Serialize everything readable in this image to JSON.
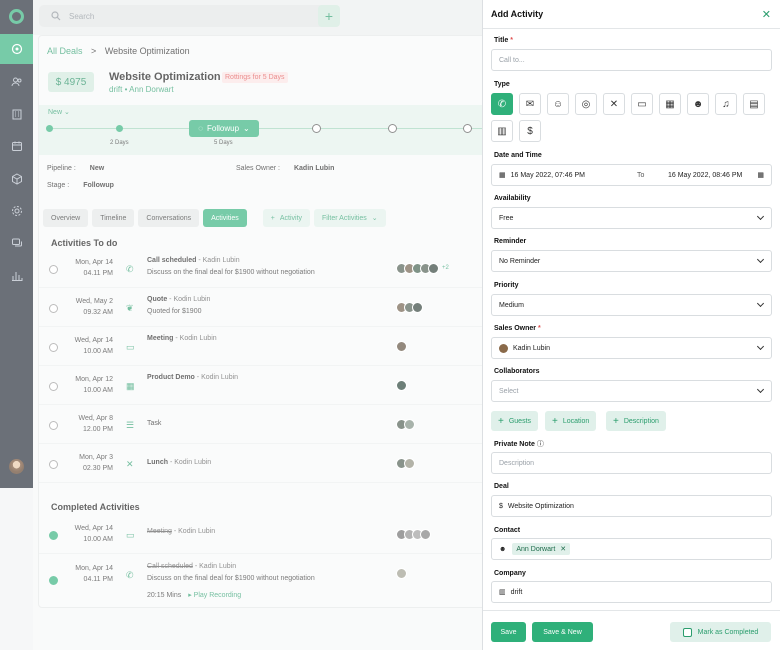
{
  "search": {
    "placeholder": "Search"
  },
  "breadcrumb": {
    "root": "All Deals",
    "current": "Website Optimization"
  },
  "deal": {
    "amount": "$ 4975",
    "title": "Website Optimization",
    "rotting": "Rottings for 5 Days",
    "company": "drift",
    "contact": "Ann Dorwart"
  },
  "pipeline": {
    "stage_dropdown": "New",
    "current_stage": "Followup",
    "days_1": "2 Days",
    "days_2": "5 Days",
    "pipeline_label": "Pipeline :",
    "pipeline_value": "New",
    "stage_label": "Stage :",
    "stage_value": "Followup",
    "owner_label": "Sales Owner :",
    "owner_value": "Kadin Lubin"
  },
  "tabs": {
    "overview": "Overview",
    "timeline": "Timeline",
    "conversations": "Conversations",
    "activities": "Activities",
    "add_activity": "Activity",
    "filter": "Filter Activities"
  },
  "todo": {
    "heading": "Activities To do",
    "rows": [
      {
        "date": "Mon, Apr 14",
        "time": "04.11 PM",
        "title": "Call scheduled",
        "who": " - Kadin Lubin",
        "desc": "Discuss on the final deal for $1900 without negotiation",
        "more": "+2"
      },
      {
        "date": "Wed, May 2",
        "time": "09.32 AM",
        "title": "Quote",
        "who": " - Kodin Lubin",
        "desc": "Quoted for $1900",
        "more": ""
      },
      {
        "date": "Wed, Apr 14",
        "time": "10.00 AM",
        "title": "Meeting",
        "who": " - Kodin Lubin",
        "desc": "",
        "more": ""
      },
      {
        "date": "Mon, Apr 12",
        "time": "10.00 AM",
        "title": "Product Demo",
        "who": " - Kodin Lubin",
        "desc": "",
        "more": ""
      },
      {
        "date": "Wed, Apr 8",
        "time": "12.00 PM",
        "title": "Task",
        "who": "",
        "desc": "",
        "more": ""
      },
      {
        "date": "Mon, Apr 3",
        "time": "02.30 PM",
        "title": "Lunch",
        "who": " - Kodin Lubin",
        "desc": "",
        "more": ""
      }
    ]
  },
  "completed": {
    "heading": "Completed Activities",
    "rows": [
      {
        "date": "Wed, Apr 14",
        "time": "10.00 AM",
        "title": "Meeting",
        "who": " - Kodin Lubin",
        "desc": ""
      },
      {
        "date": "Mon, Apr 14",
        "time": "04.11 PM",
        "title": "Call scheduled",
        "who": " - Kadin Lubin",
        "desc": "Discuss on the final deal for $1900 without negotiation",
        "duration": "20:15 Mins",
        "recording": "Play Recording"
      }
    ]
  },
  "panel": {
    "title": "Add Activity",
    "title_label": "Title",
    "title_placeholder": "Call to...",
    "type_label": "Type",
    "date_label": "Date and Time",
    "date_from": "16 May 2022, 07:46 PM",
    "date_to_sep": "To",
    "date_to": "16 May 2022, 08:46 PM",
    "availability_label": "Availability",
    "availability_value": "Free",
    "reminder_label": "Reminder",
    "reminder_value": "No Reminder",
    "priority_label": "Priority",
    "priority_value": "Medium",
    "owner_label": "Sales Owner",
    "owner_value": "Kadin Lubin",
    "collab_label": "Collaborators",
    "collab_placeholder": "Select",
    "guests_btn": "Guests",
    "location_btn": "Location",
    "description_btn": "Description",
    "note_label": "Private Note",
    "note_placeholder": "Description",
    "deal_label": "Deal",
    "deal_value": "Website Optimization",
    "contact_label": "Contact",
    "contact_value": "Ann Dorwart",
    "company_label": "Company",
    "company_value": "drift",
    "save_btn": "Save",
    "save_new_btn": "Save & New",
    "mark_completed": "Mark as Completed"
  },
  "colors": {
    "accent": "#2fb07a",
    "sidebar": "#1d2430",
    "danger": "#e05050"
  }
}
